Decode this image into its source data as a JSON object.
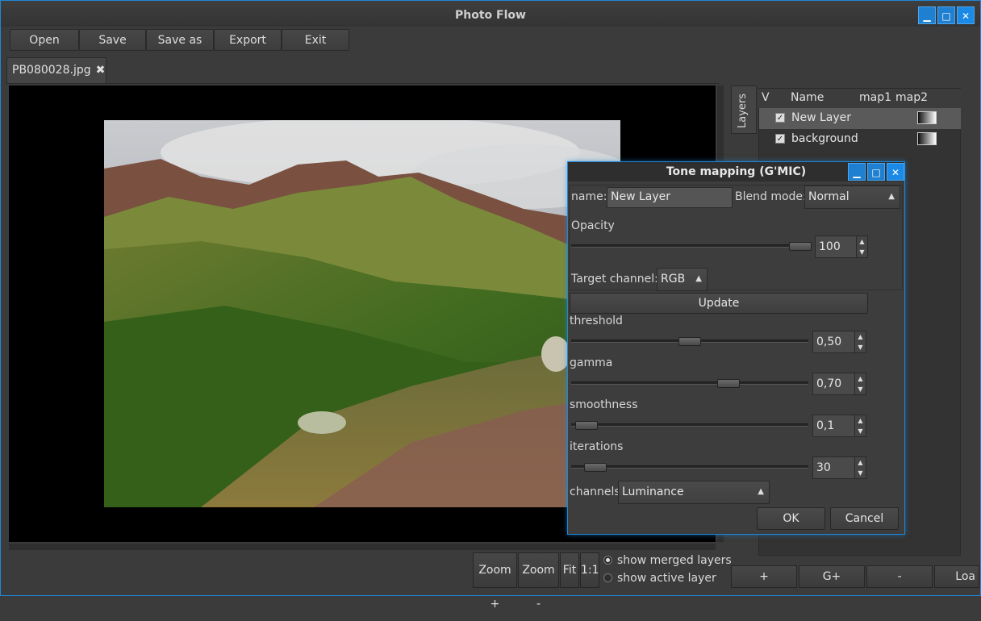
{
  "window": {
    "title": "Photo Flow"
  },
  "toolbar": {
    "open": "Open",
    "save": "Save",
    "save_as": "Save as",
    "export": "Export",
    "exit": "Exit"
  },
  "tabs": [
    {
      "label": "PB080028.jpg",
      "close": "✖"
    }
  ],
  "view": {
    "zoom_in": "Zoom +",
    "zoom_out": "Zoom -",
    "fit": "Fit",
    "one_to_one": "1:1",
    "show_merged": "show merged layers",
    "show_active": "show active layer",
    "selected_mode": "show merged layers"
  },
  "layers_panel": {
    "tab_label": "Layers",
    "columns": [
      "V",
      "Name",
      "map1",
      "map2"
    ],
    "rows": [
      {
        "name": "New Layer",
        "visible": true,
        "selected": true
      },
      {
        "name": "background",
        "visible": true,
        "selected": false
      }
    ],
    "buttons": {
      "add": "+",
      "add_group": "G+",
      "remove": "-",
      "load": "Loa"
    }
  },
  "dialog": {
    "title": "Tone mapping (G'MIC)",
    "name_label": "name:",
    "name_value": "New Layer",
    "blend_label": "Blend mode:",
    "blend_value": "Normal",
    "opacity_label": "Opacity",
    "opacity_value": "100",
    "target_label": "Target channel:",
    "target_value": "RGB",
    "update_label": "Update",
    "params": [
      {
        "label": "threshold",
        "value": "0,50",
        "level": 0.5
      },
      {
        "label": "gamma",
        "value": "0,70",
        "level": 0.68
      },
      {
        "label": "smoothness",
        "value": "0,1",
        "level": 0.02
      },
      {
        "label": "iterations",
        "value": "30",
        "level": 0.06
      }
    ],
    "channels_label": "channels",
    "channels_value": "Luminance",
    "ok_label": "OK",
    "cancel_label": "Cancel"
  },
  "colors": {
    "accent": "#1f87d8",
    "background": "#3b3b3b"
  }
}
